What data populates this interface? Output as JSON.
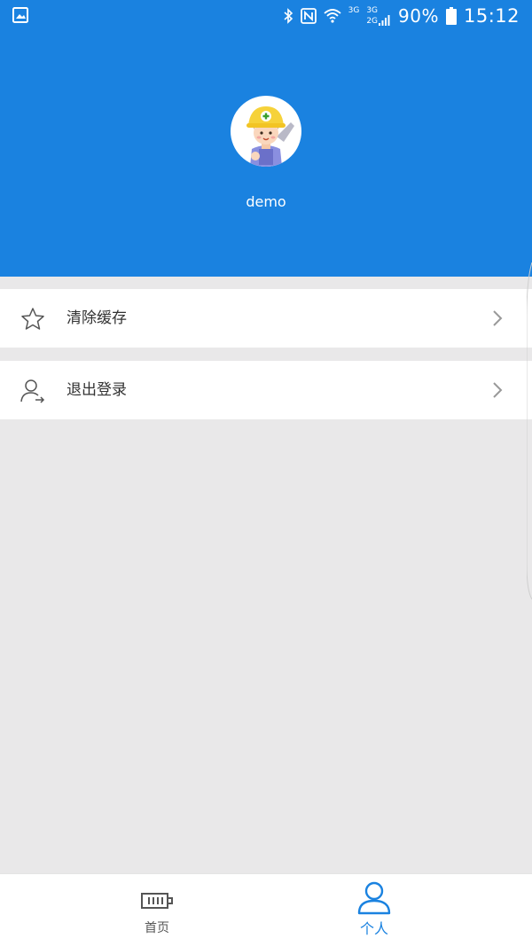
{
  "status_bar": {
    "gallery_icon": "image-icon",
    "bluetooth_icon": "bluetooth-icon",
    "nfc_icon": "nfc-icon",
    "wifi_icon": "wifi-icon",
    "net1": "3G",
    "net2_top": "3G",
    "net2_bottom": "2G",
    "battery": "90%",
    "time": "15:12"
  },
  "profile": {
    "avatar_icon": "worker-avatar-icon",
    "username": "demo"
  },
  "menu": {
    "items": [
      {
        "label": "清除缓存",
        "icon": "star-icon"
      },
      {
        "label": "退出登录",
        "icon": "logout-user-icon"
      }
    ]
  },
  "tabbar": {
    "tabs": [
      {
        "label": "首页",
        "icon": "battery-home-icon",
        "active": false
      },
      {
        "label": "个人",
        "icon": "person-icon",
        "active": true
      }
    ]
  },
  "colors": {
    "primary": "#1a82e0",
    "background": "#e9e8e9",
    "text": "#333333"
  }
}
